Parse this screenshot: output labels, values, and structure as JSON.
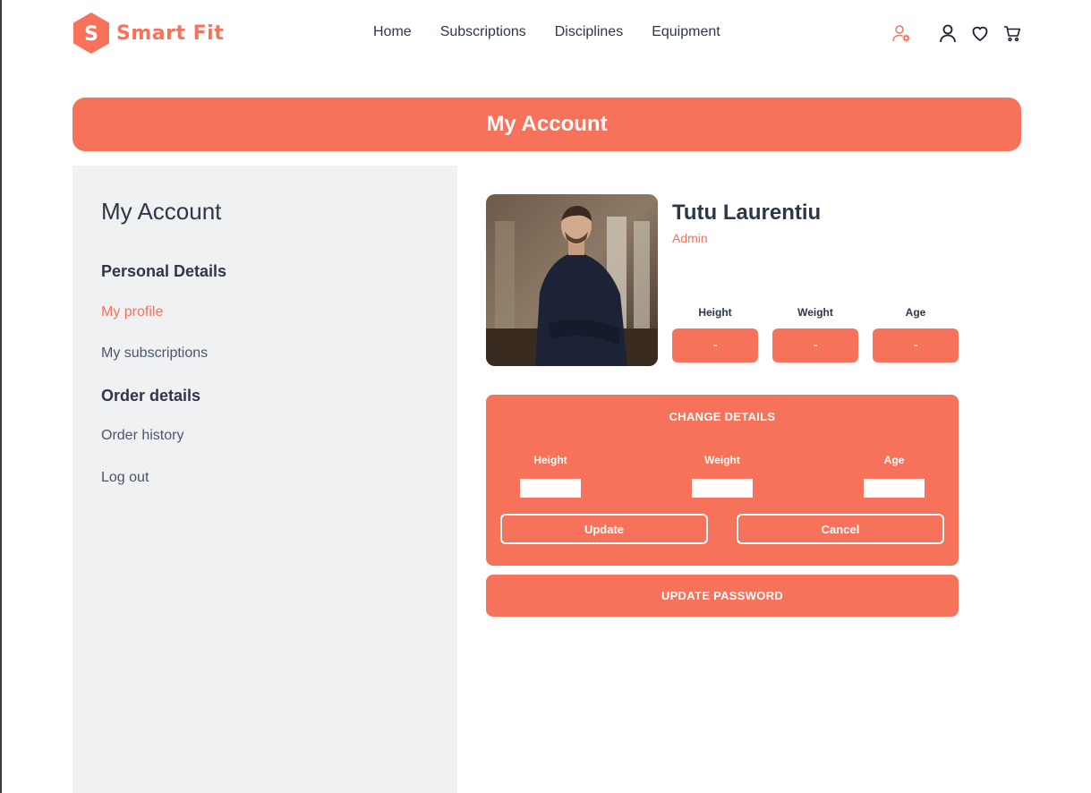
{
  "colors": {
    "accent": "#f7725a",
    "sidebar_bg": "#f0f1f3",
    "text": "#2d3748"
  },
  "brand": {
    "logo_letter": "S",
    "name": "Smart Fit"
  },
  "nav": {
    "items": [
      "Home",
      "Subscriptions",
      "Disciplines",
      "Equipment"
    ]
  },
  "header_icons": [
    "user-settings-icon",
    "user-icon",
    "heart-icon",
    "cart-icon"
  ],
  "banner": {
    "title": "My Account"
  },
  "sidebar": {
    "title": "My Account",
    "personal_heading": "Personal Details",
    "my_profile": "My profile",
    "my_subscriptions": "My subscriptions",
    "order_heading": "Order details",
    "order_history": "Order history",
    "logout": "Log out"
  },
  "profile": {
    "name": "Tutu Laurentiu",
    "role": "Admin",
    "stats": [
      {
        "label": "Height",
        "value": "-"
      },
      {
        "label": "Weight",
        "value": "-"
      },
      {
        "label": "Age",
        "value": "-"
      }
    ]
  },
  "change_details": {
    "title": "CHANGE DETAILS",
    "fields": [
      {
        "label": "Height",
        "value": ""
      },
      {
        "label": "Weight",
        "value": ""
      },
      {
        "label": "Age",
        "value": ""
      }
    ],
    "update_label": "Update",
    "cancel_label": "Cancel"
  },
  "update_password": {
    "label": "UPDATE PASSWORD"
  }
}
